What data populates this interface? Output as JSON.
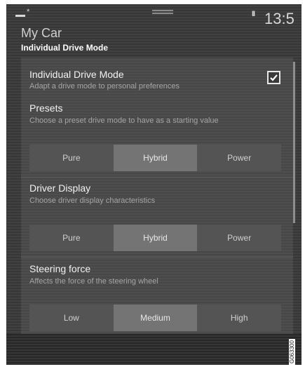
{
  "status_bar": {
    "time": "13:5",
    "signal_icon": "signal-icon",
    "bluetooth_icon": "bluetooth-icon",
    "pause_symbol": "II"
  },
  "header": {
    "title": "My Car",
    "subtitle": "Individual Drive Mode"
  },
  "idm": {
    "title": "Individual Drive Mode",
    "description": "Adapt a drive mode to personal preferences",
    "checked": true
  },
  "presets": {
    "title": "Presets",
    "description": "Choose a preset drive mode to have as a starting value",
    "options": [
      "Pure",
      "Hybrid",
      "Power"
    ],
    "selected": "Hybrid"
  },
  "driver_display": {
    "title": "Driver Display",
    "description": "Choose driver display characteristics",
    "options": [
      "Pure",
      "Hybrid",
      "Power"
    ],
    "selected": "Hybrid"
  },
  "steering": {
    "title": "Steering force",
    "description": "Affects the force of the steering wheel",
    "options": [
      "Low",
      "Medium",
      "High"
    ],
    "selected": "Medium"
  },
  "figure_code": "G063300"
}
